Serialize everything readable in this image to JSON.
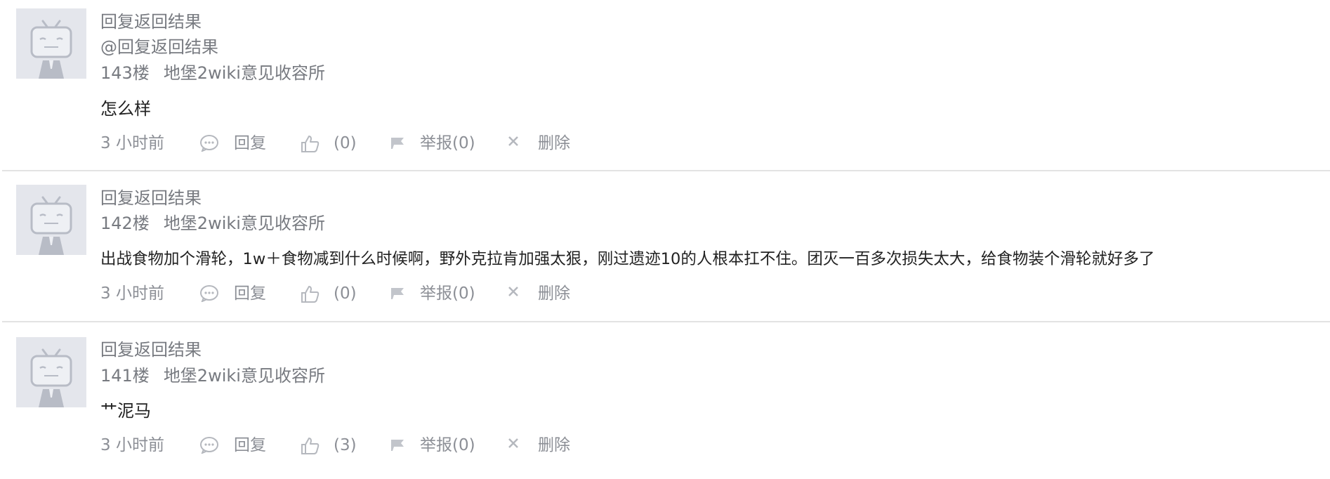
{
  "comments": [
    {
      "author": "回复返回结果",
      "mention": "@回复返回结果",
      "floor": "143楼",
      "source": "地堡2wiki意见收容所",
      "content": "怎么样",
      "time": "3 小时前",
      "reply_label": "回复",
      "like_count": "(0)",
      "report_label": "举报(0)",
      "delete_label": "删除"
    },
    {
      "author": "回复返回结果",
      "floor": "142楼",
      "source": "地堡2wiki意见收容所",
      "content": "出战食物加个滑轮，1w＋食物减到什么时候啊，野外克拉肯加强太狠，刚过遗迹10的人根本扛不住。团灭一百多次损失太大，给食物装个滑轮就好多了",
      "time": "3 小时前",
      "reply_label": "回复",
      "like_count": "(0)",
      "report_label": "举报(0)",
      "delete_label": "删除"
    },
    {
      "author": "回复返回结果",
      "floor": "141楼",
      "source": "地堡2wiki意见收容所",
      "content": "艹泥马",
      "time": "3 小时前",
      "reply_label": "回复",
      "like_count": "(3)",
      "report_label": "举报(0)",
      "delete_label": "删除"
    }
  ],
  "icons": {
    "avatar": "default-tv-avatar-icon",
    "reply": "chat-bubble-icon",
    "like": "thumbs-up-icon",
    "report": "flag-icon",
    "delete": "close-icon"
  },
  "colors": {
    "meta_text": "#777a80",
    "content_text": "#222222",
    "action_text": "#8c8f96",
    "avatar_bg": "#e4e6ec",
    "avatar_fg": "#b8bcc6",
    "divider": "#e3e3e3"
  }
}
